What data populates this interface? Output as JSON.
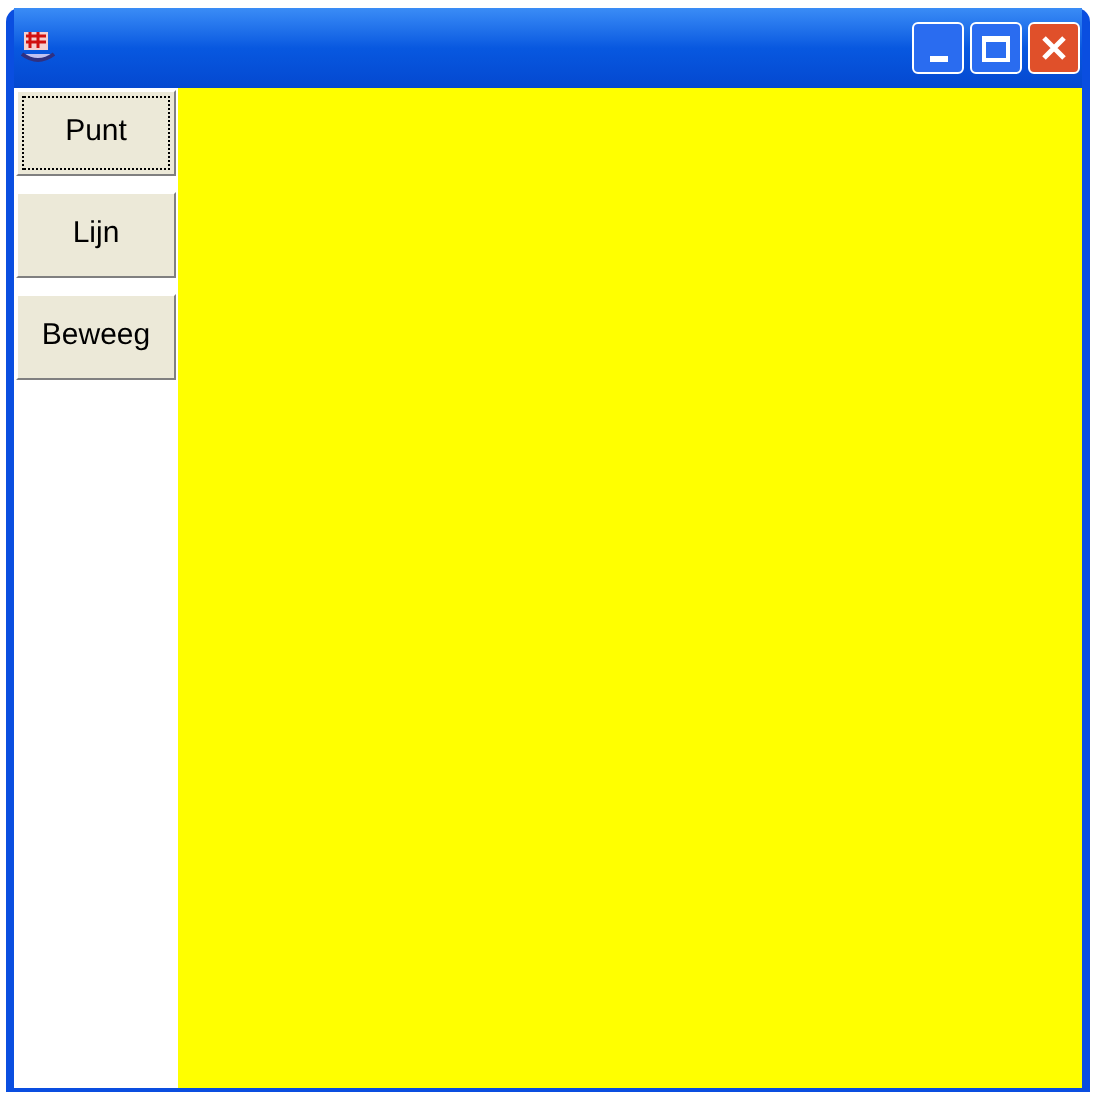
{
  "buttons": [
    {
      "label": "Punt",
      "focused": true
    },
    {
      "label": "Lijn",
      "focused": false
    },
    {
      "label": "Beweeg",
      "focused": false
    }
  ]
}
